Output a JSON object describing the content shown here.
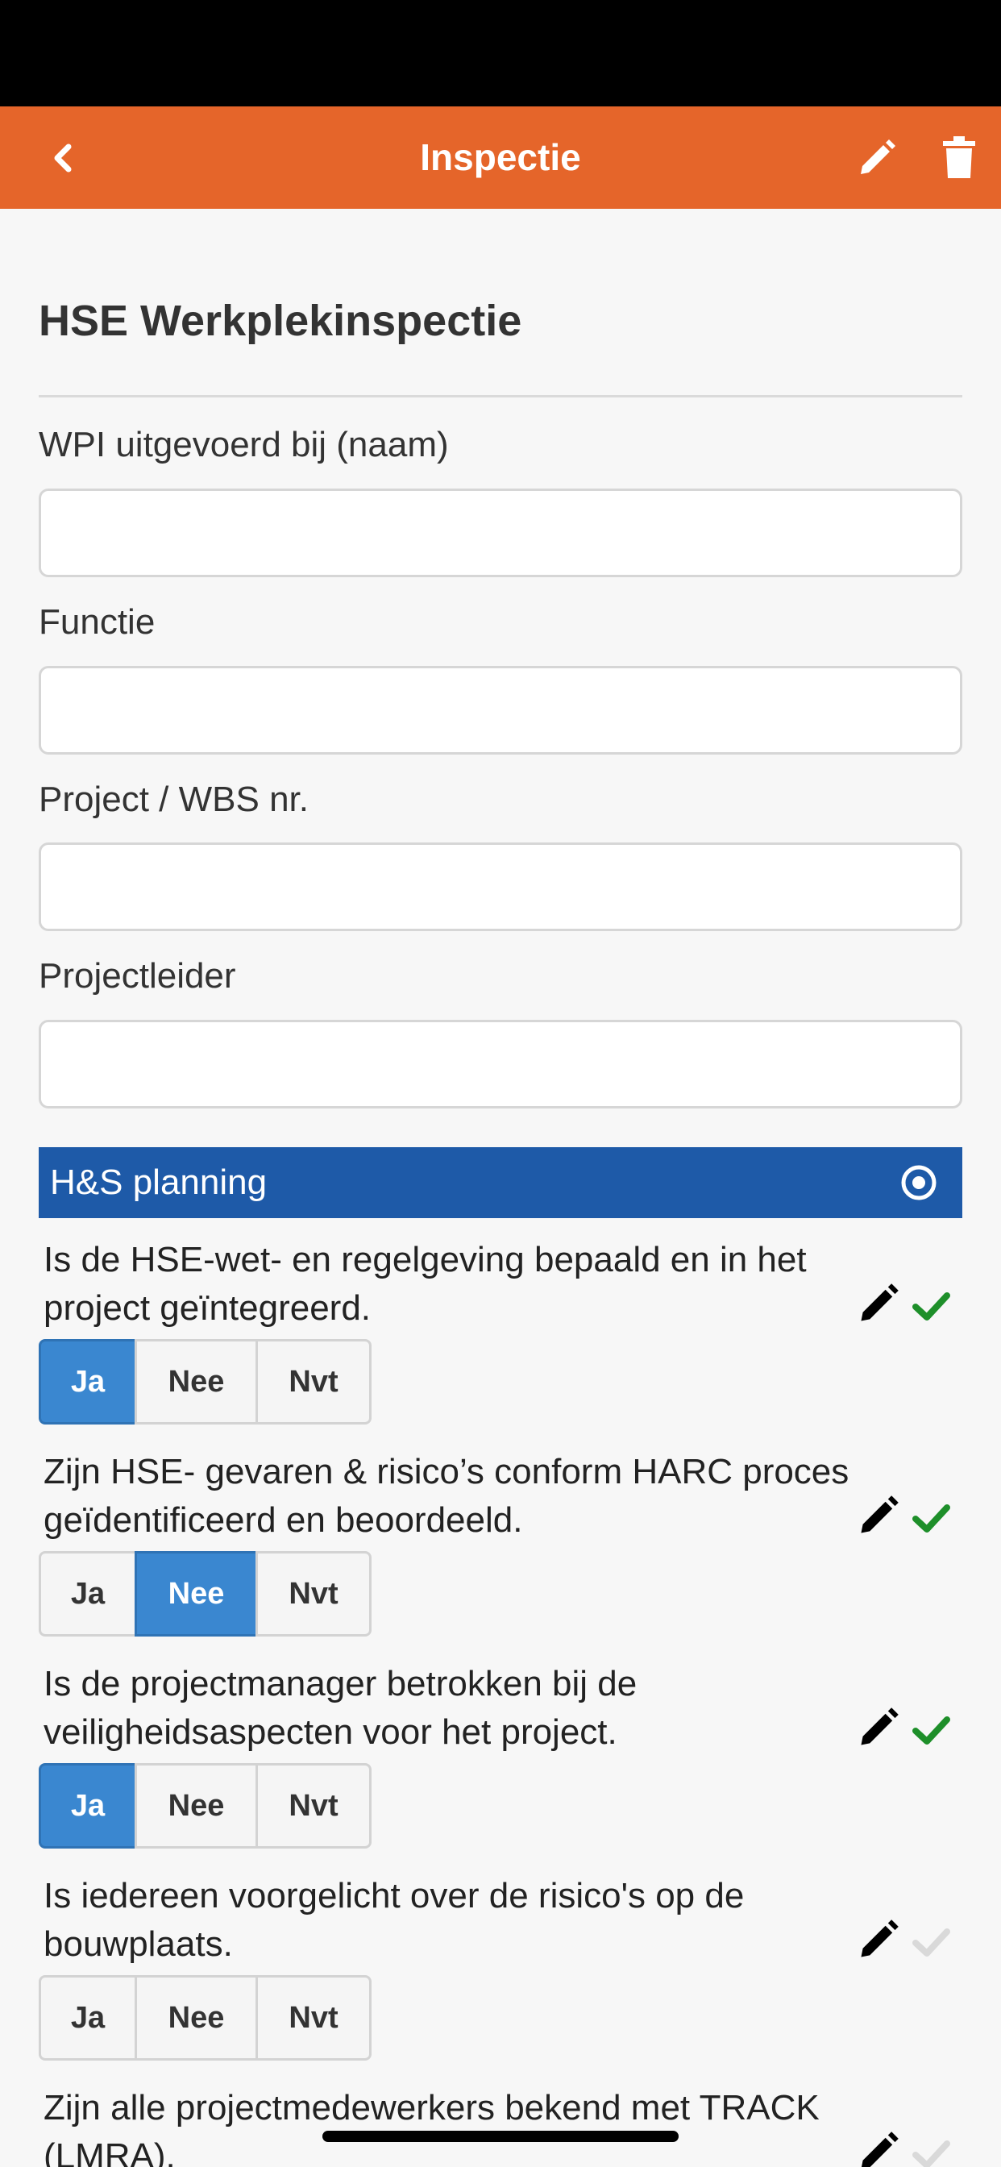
{
  "nav": {
    "title": "Inspectie",
    "icons": {
      "back": "chevron-left-icon",
      "edit": "pencil-icon",
      "delete": "trash-icon"
    }
  },
  "page": {
    "title": "HSE Werkplekinspectie"
  },
  "fields": [
    {
      "label": "WPI uitgevoerd bij (naam)",
      "value": ""
    },
    {
      "label": "Functie",
      "value": ""
    },
    {
      "label": "Project / WBS nr.",
      "value": ""
    },
    {
      "label": "Projectleider",
      "value": ""
    }
  ],
  "section": {
    "title": "H&S planning",
    "icon": "radio-target-icon"
  },
  "options": [
    "Ja",
    "Nee",
    "Nvt"
  ],
  "questions": [
    {
      "text": "Is de HSE-wet- en regelgeving bepaald en in het project geïntegreerd.",
      "selected": "Ja",
      "answered": true
    },
    {
      "text": "Zijn HSE- gevaren & risico’s conform HARC proces geïdentificeerd en beoordeeld.",
      "selected": "Nee",
      "answered": true
    },
    {
      "text": "Is de projectmanager betrokken bij de veiligheidsaspecten voor het project.",
      "selected": "Ja",
      "answered": true
    },
    {
      "text": "Is iedereen voorgelicht over de risico's op de bouwplaats.",
      "selected": "",
      "answered": false
    },
    {
      "text": "Zijn alle projectmedewerkers bekend met TRACK (LMRA).",
      "selected": "",
      "answered": false
    }
  ],
  "colors": {
    "nav": "#e5652a",
    "section": "#1e5aa8",
    "selected": "#3a87d0",
    "check_done": "#1e8f2a",
    "check_pending": "#d9d9d9"
  }
}
